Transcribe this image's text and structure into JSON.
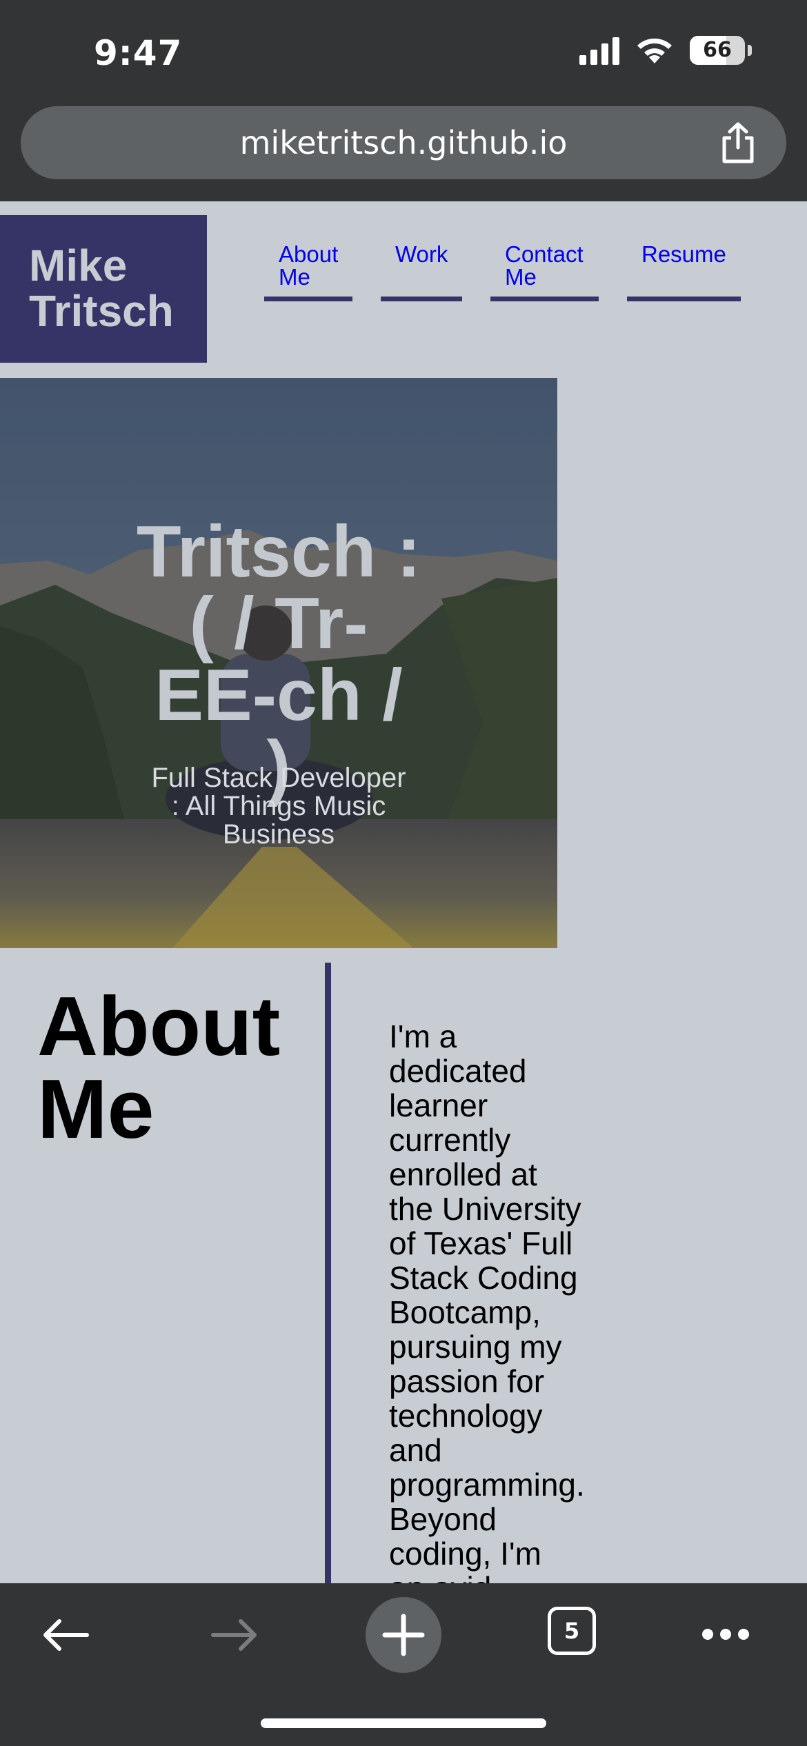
{
  "status_bar": {
    "time": "9:47",
    "battery_level": "66"
  },
  "browser": {
    "url": "miketritsch.github.io",
    "tab_count": "5",
    "icons": {
      "share": "share-icon",
      "back": "arrow-left-icon",
      "forward": "arrow-right-icon",
      "new_tab": "plus-icon",
      "tabs": "tabs-icon",
      "more": "ellipsis-icon"
    }
  },
  "site": {
    "logo": [
      "Mike",
      "Tritsch"
    ],
    "nav": [
      {
        "label_lines": [
          "About",
          "Me"
        ]
      },
      {
        "label_lines": [
          "Work"
        ]
      },
      {
        "label_lines": [
          "Contact",
          "Me"
        ]
      },
      {
        "label_lines": [
          "Resume"
        ]
      }
    ],
    "hero": {
      "title_lines": [
        "Tritsch :",
        "( / Tr-",
        "EE-ch /",
        ")"
      ],
      "subtitle_lines": [
        "Full Stack Developer",
        ": All Things Music",
        "Business"
      ]
    },
    "about": {
      "heading_lines": [
        "About",
        "Me"
      ],
      "body_lines": [
        "I'm a",
        "dedicated",
        "learner",
        "currently",
        "enrolled at",
        "the University",
        "of Texas' Full",
        "Stack Coding",
        "Bootcamp,",
        "pursuing my",
        "passion for",
        "technology",
        "and",
        "programming.",
        "Beyond",
        "coding, I'm",
        "an avid"
      ]
    }
  },
  "colors": {
    "page_bg": "#c8ccd3",
    "brand_navy": "#363467",
    "link": "#0000ee",
    "browser_chrome": "#333436"
  }
}
